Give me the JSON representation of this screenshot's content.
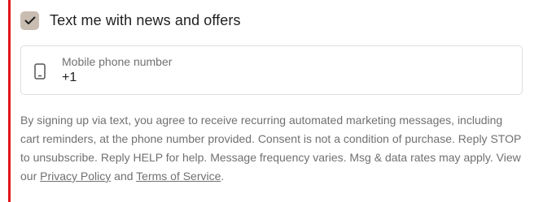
{
  "sms_optin": {
    "checked": true,
    "label": "Text me with news and offers"
  },
  "phone_field": {
    "label": "Mobile phone number",
    "value": "+1",
    "icon": "mobile-phone-icon"
  },
  "disclaimer": {
    "text_before": "By signing up via text, you agree to receive recurring automated marketing messages, including cart reminders, at the phone number provided. Consent is not a condition of purchase. Reply STOP to unsubscribe. Reply HELP for help. Message frequency varies. Msg & data rates may apply. View our ",
    "privacy_link": "Privacy Policy",
    "and_text": " and ",
    "terms_link": "Terms of Service",
    "end_text": "."
  },
  "colors": {
    "accent_bar": "#e0161b",
    "checkbox_fill": "#c9bdb2"
  }
}
